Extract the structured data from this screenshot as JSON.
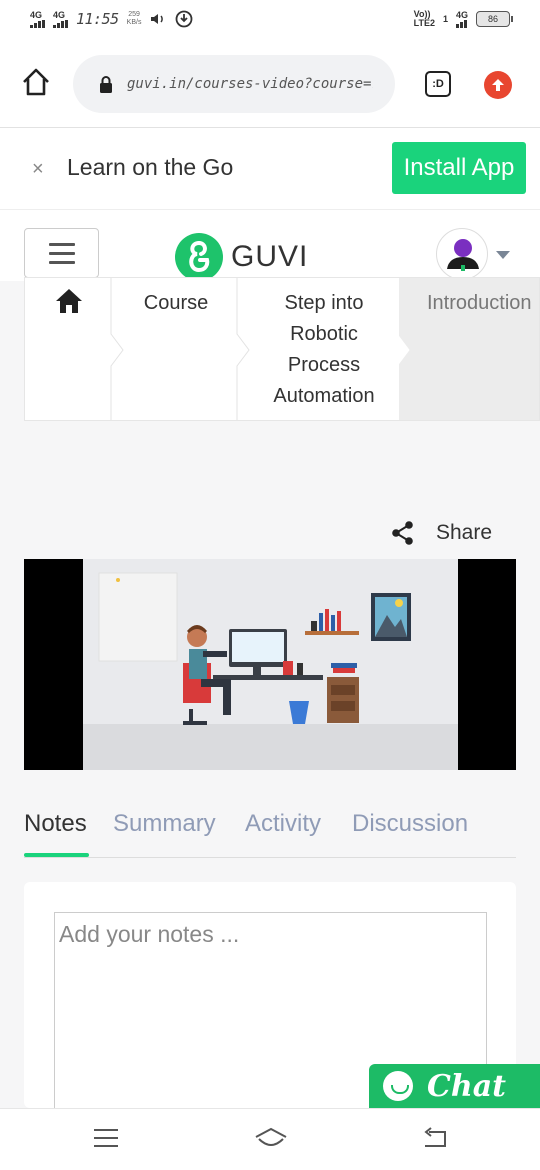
{
  "status_bar": {
    "net1": "4G",
    "net2": "4G",
    "time": "11:55",
    "speed_value": "259",
    "speed_unit": "KB/s",
    "volte": "Vo))",
    "lte": "LTE2",
    "net_right": "4G",
    "sim": "1",
    "battery": "86"
  },
  "browser": {
    "url": "guvi.in/courses-video?course=rpa_e",
    "tabs_label": ":D",
    "icons": [
      "home-icon",
      "lock-icon",
      "tabs-icon",
      "update-icon"
    ]
  },
  "banner": {
    "close": "×",
    "text": "Learn on the Go",
    "install_label": "Install App"
  },
  "header": {
    "logo_text": "GUVI",
    "accent": "#1ec36b"
  },
  "breadcrumb": {
    "items": [
      {
        "label": "",
        "icon": "home-icon"
      },
      {
        "label": "Course"
      },
      {
        "label": "Step into Robotic Process Automation"
      },
      {
        "label": "Introduction"
      }
    ]
  },
  "share": {
    "label": "Share",
    "icon": "share-icon"
  },
  "tabs": [
    {
      "label": "Notes",
      "active": true
    },
    {
      "label": "Summary"
    },
    {
      "label": "Activity"
    },
    {
      "label": "Discussion"
    }
  ],
  "notes": {
    "placeholder": "Add your notes ..."
  },
  "chat": {
    "label": "Chat"
  },
  "nav": {
    "icons": [
      "recents-icon",
      "home-icon",
      "back-icon"
    ]
  },
  "colors": {
    "green": "#1ad37c",
    "tab_inactive": "#8f9bb6",
    "update_red": "#e84630"
  }
}
